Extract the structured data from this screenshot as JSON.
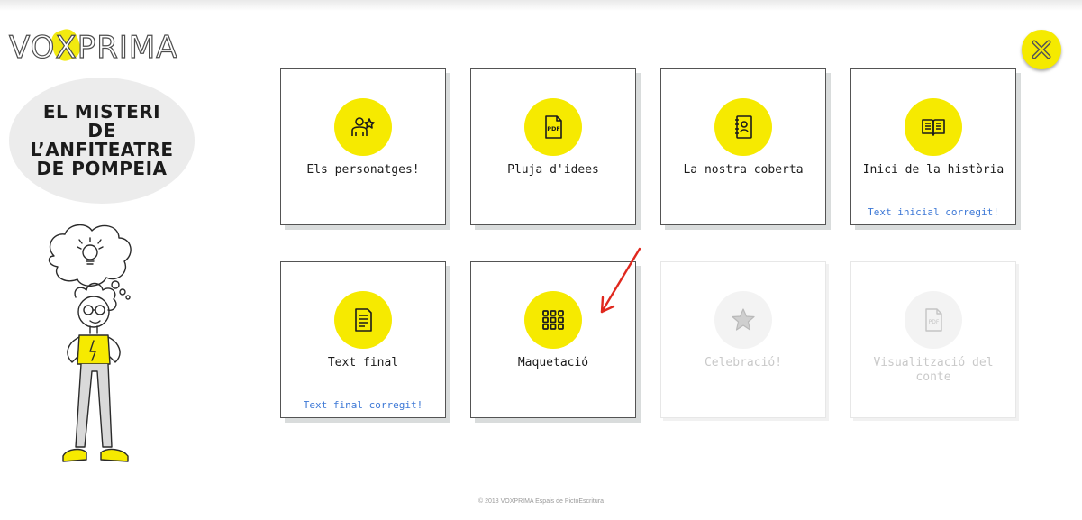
{
  "app": {
    "logo_text_left": "VO",
    "logo_text_x": "X",
    "logo_text_right": "PRIMA",
    "close_icon": "close-x-icon"
  },
  "story": {
    "title": "EL MISTERI\nDE\nL’ANFITEATRE\nDE POMPEIA"
  },
  "colors": {
    "accent_yellow": "#f6ea00",
    "link_blue": "#3d78d6",
    "card_border": "#545454",
    "annotation_red": "#e0281e"
  },
  "cards": [
    {
      "label": "Els personatges!",
      "icon": "characters-star-icon",
      "enabled": true,
      "note": ""
    },
    {
      "label": "Pluja d'idees",
      "icon": "pdf-document-icon",
      "enabled": true,
      "note": ""
    },
    {
      "label": "La nostra coberta",
      "icon": "cover-book-icon",
      "enabled": true,
      "note": ""
    },
    {
      "label": "Inici de la història",
      "icon": "open-book-icon",
      "enabled": true,
      "note": "Text inicial corregit!"
    },
    {
      "label": "Text final",
      "icon": "text-document-icon",
      "enabled": true,
      "note": "Text final corregit!"
    },
    {
      "label": "Maquetació",
      "icon": "layout-grid-icon",
      "enabled": true,
      "note": ""
    },
    {
      "label": "Celebració!",
      "icon": "star-icon",
      "enabled": false,
      "note": ""
    },
    {
      "label": "Visualització del conte",
      "icon": "pdf-file-icon",
      "enabled": false,
      "note": ""
    }
  ],
  "footer": {
    "copyright": "© 2018 VOXPRIMA Espais de PictoEscritura"
  }
}
